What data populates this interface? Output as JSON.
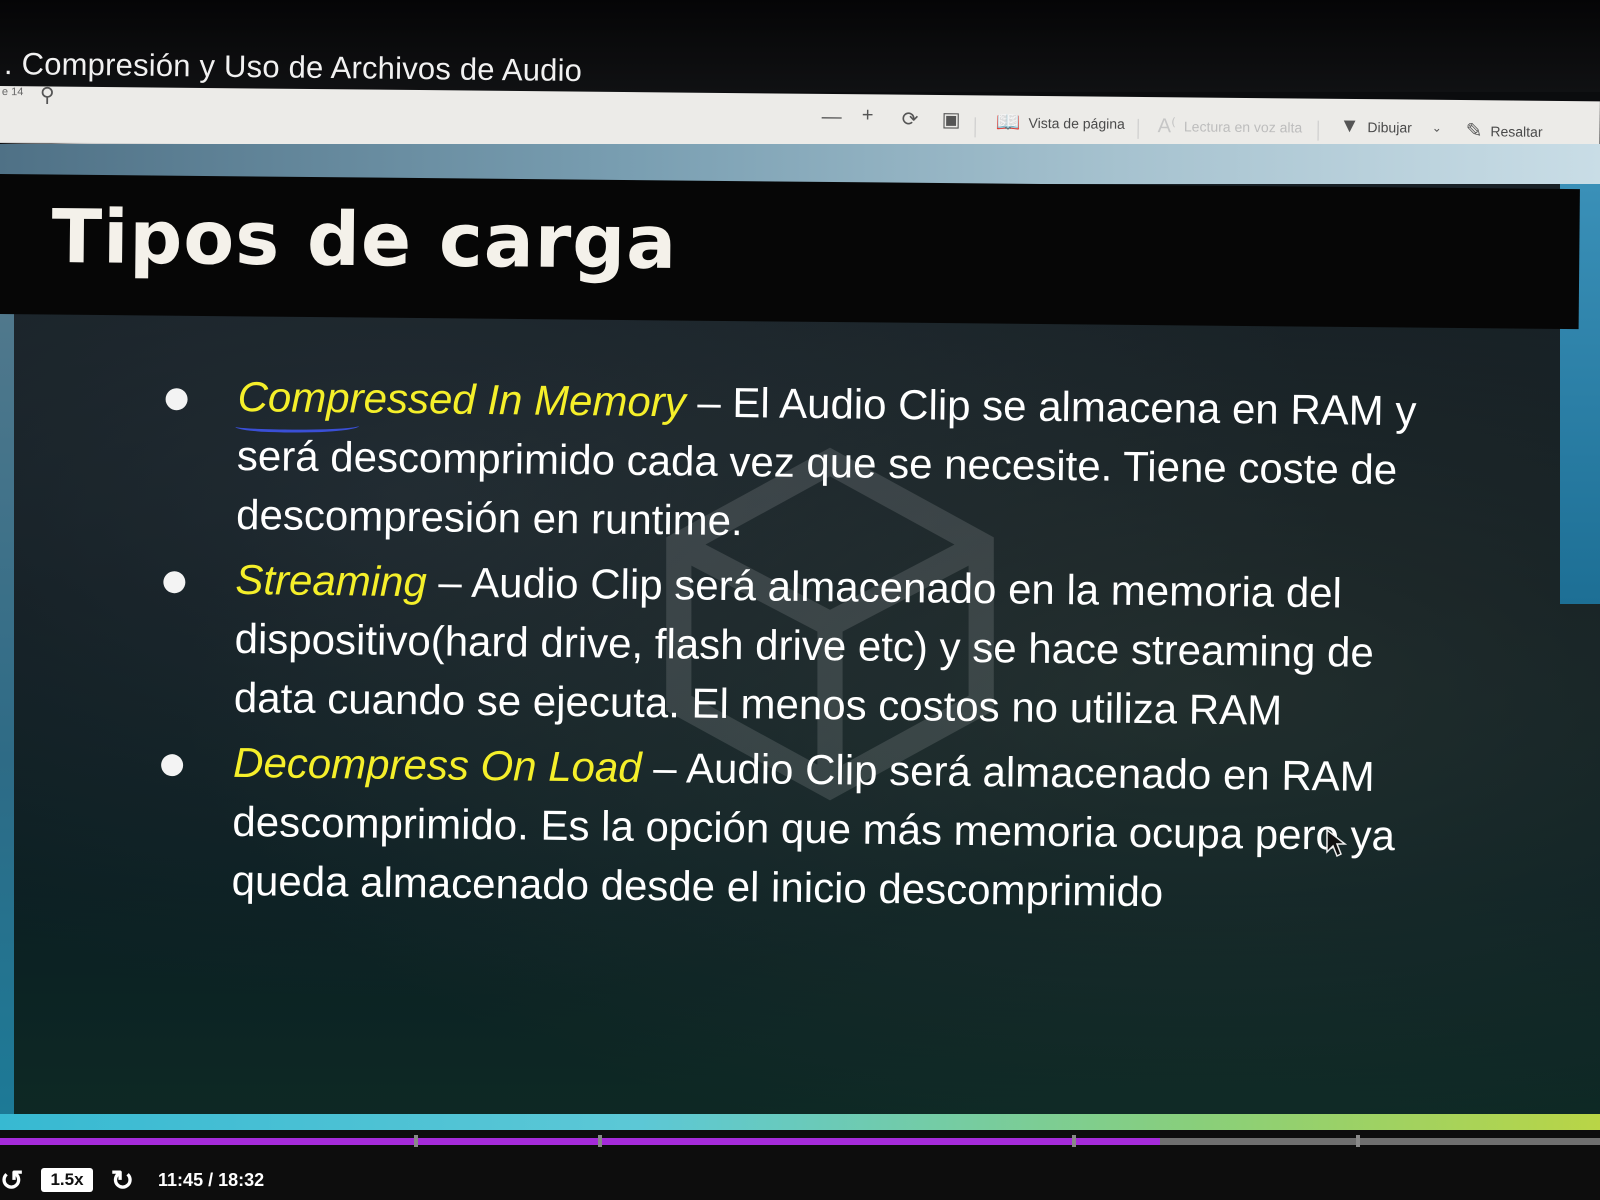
{
  "window": {
    "title": ". Compresión y Uso de Archivos de Audio",
    "page_indicator": "e 14"
  },
  "toolbar": {
    "zoom_out": "—",
    "zoom_in": "+",
    "page_view_label": "Vista de página",
    "read_aloud_label": "Lectura en voz alta",
    "draw_label": "Dibujar",
    "highlight_label": "Resaltar"
  },
  "slide": {
    "title": "Tipos de carga",
    "bullets": [
      {
        "term": "Compressed In Memory",
        "text": " –  El Audio Clip se almacena en RAM y será descomprimido cada vez que se necesite. Tiene coste de descompresión en runtime."
      },
      {
        "term": "Streaming",
        "text": " – Audio Clip será almacenado en la memoria del dispositivo(hard drive, flash drive etc) y se hace streaming de data cuando se ejecuta. El menos costos no utiliza RAM"
      },
      {
        "term": "Decompress On Load",
        "text": " – Audio Clip será almacenado en RAM descomprimido. Es la opción que más memoria ocupa pero ya queda almacenado desde el inicio descomprimido"
      }
    ]
  },
  "player": {
    "speed": "1.5x",
    "time": "11:45 / 18:32",
    "progress": 0.725,
    "colors": {
      "progress": "#a52bd9",
      "track": "#6f6f6f"
    }
  },
  "colors": {
    "term_highlight": "#f5ef2a",
    "slide_title": "#f4f1ea",
    "draw_underline": "#2b5fb4"
  }
}
